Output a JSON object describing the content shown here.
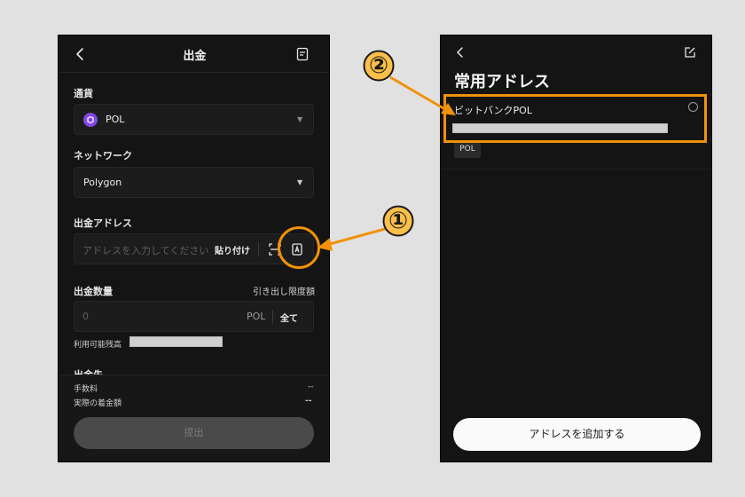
{
  "withdraw": {
    "title": "出金",
    "currency_label": "通貨",
    "currency_value": "POL",
    "network_label": "ネットワーク",
    "network_value": "Polygon",
    "address_label": "出金アドレス",
    "address_placeholder": "アドレスを入力してください",
    "paste_label": "貼り付け",
    "amount_label": "出金数量",
    "limit_label": "引き出し限度額",
    "amount_placeholder": "0",
    "amount_unit": "POL",
    "all_label": "全て",
    "balance_label": "利用可能残高",
    "dest_label": "出金先",
    "fee_label": "手数料",
    "fee_value": "--",
    "actual_label": "実際の着金額",
    "actual_value": "--",
    "submit_label": "提出"
  },
  "addresses": {
    "title": "常用アドレス",
    "item_name": "ビットバンクPOL",
    "item_tag": "POL",
    "add_button_label": "アドレスを追加する"
  },
  "annotations": {
    "step1": "①",
    "step2": "②",
    "accent_color": "#f0920a"
  }
}
